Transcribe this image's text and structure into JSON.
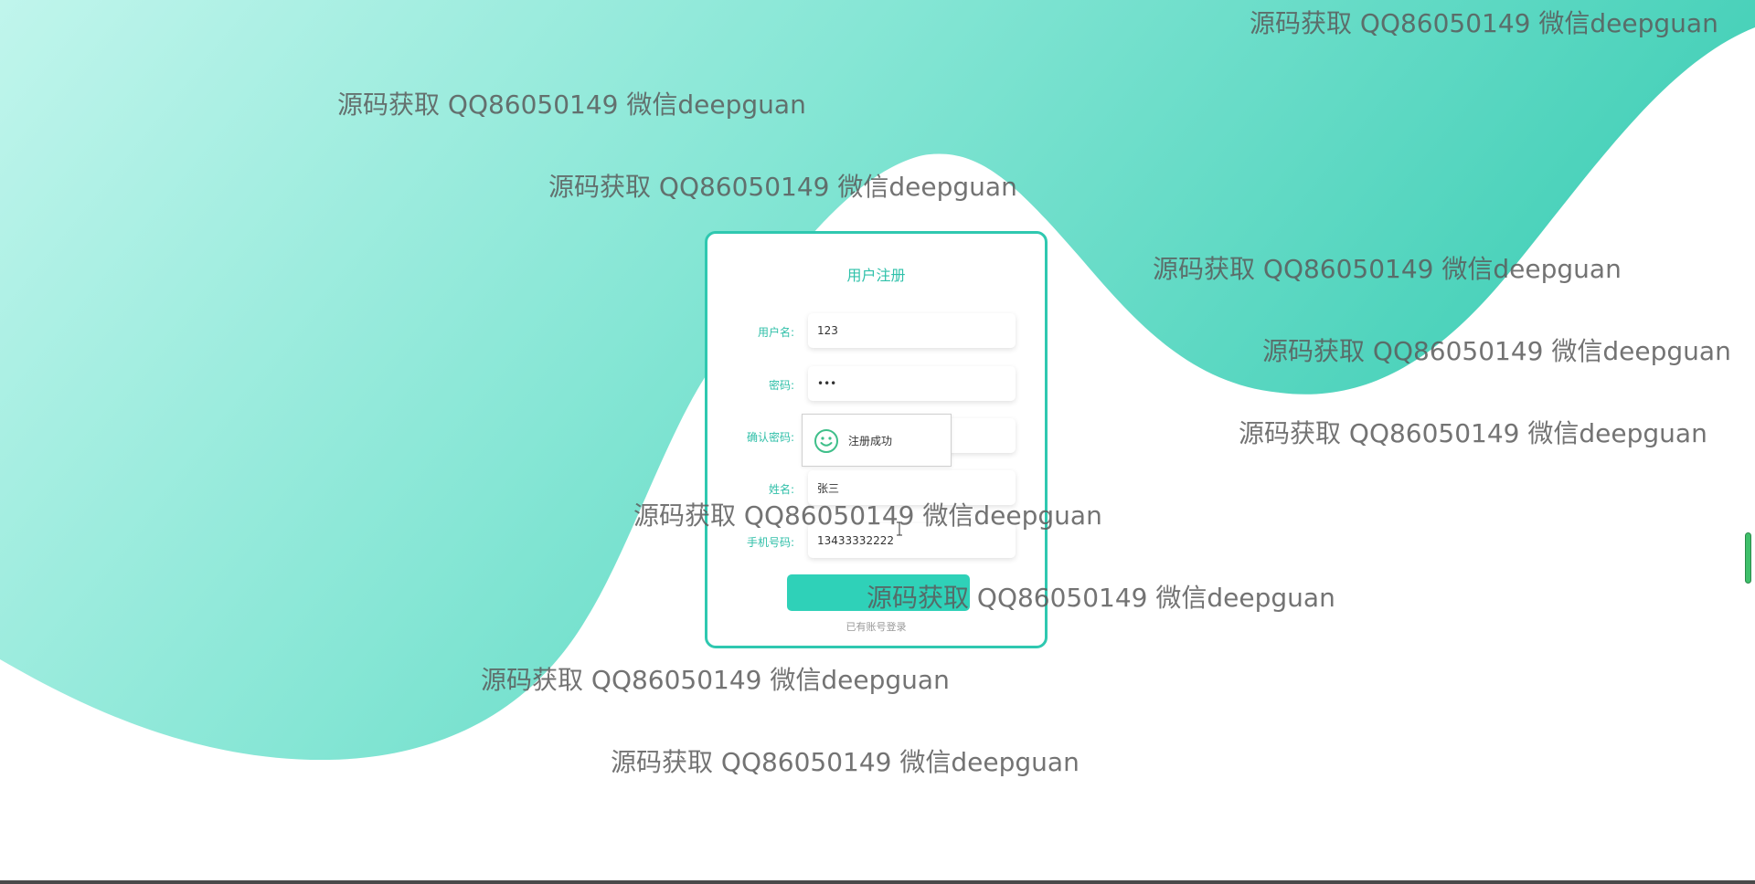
{
  "colors": {
    "accent": "#2fc8b0",
    "button": "#2fd1b8",
    "wave_light": "#b8f2e8",
    "wave_dark": "#3fcfb6",
    "scrollbar": "#3fbf6a"
  },
  "form": {
    "title": "用户注册",
    "fields": [
      {
        "label": "用户名:",
        "value": "123",
        "type": "text"
      },
      {
        "label": "密码:",
        "value": "•••",
        "type": "password"
      },
      {
        "label": "确认密码:",
        "value": "",
        "type": "password"
      },
      {
        "label": "姓名:",
        "value": "张三",
        "type": "text"
      },
      {
        "label": "手机号码:",
        "value": "13433332222",
        "type": "text"
      }
    ],
    "submit_label": "",
    "login_link": "已有账号登录"
  },
  "toast": {
    "icon": "smile-icon",
    "message": "注册成功"
  },
  "watermark": {
    "text": "源码获取 QQ86050149 微信deepguan"
  }
}
